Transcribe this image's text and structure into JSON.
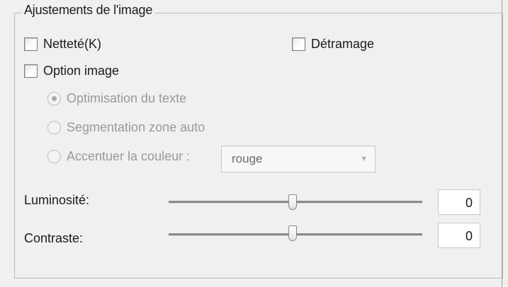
{
  "group": {
    "title": "Ajustements de l'image"
  },
  "checkboxes": {
    "sharpness": {
      "label": "Netteté(K)",
      "checked": false
    },
    "descreening": {
      "label": "Détramage",
      "checked": false
    },
    "image_option": {
      "label": "Option image",
      "checked": false
    }
  },
  "radios": {
    "text_enhancement": {
      "label": "Optimisation du texte",
      "selected": true
    },
    "auto_area_segmentation": {
      "label": "Segmentation zone auto",
      "selected": false
    },
    "color_enhance": {
      "label": "Accentuer la couleur :",
      "selected": false
    }
  },
  "color_dropdown": {
    "value": "rouge"
  },
  "sliders": {
    "brightness": {
      "label": "Luminosité:",
      "value": "0",
      "level": 0.5
    },
    "contrast": {
      "label": "Contraste:",
      "value": "0",
      "level": 0.5
    }
  },
  "icons": {
    "dropdown_arrow": "chevron-down-icon"
  }
}
